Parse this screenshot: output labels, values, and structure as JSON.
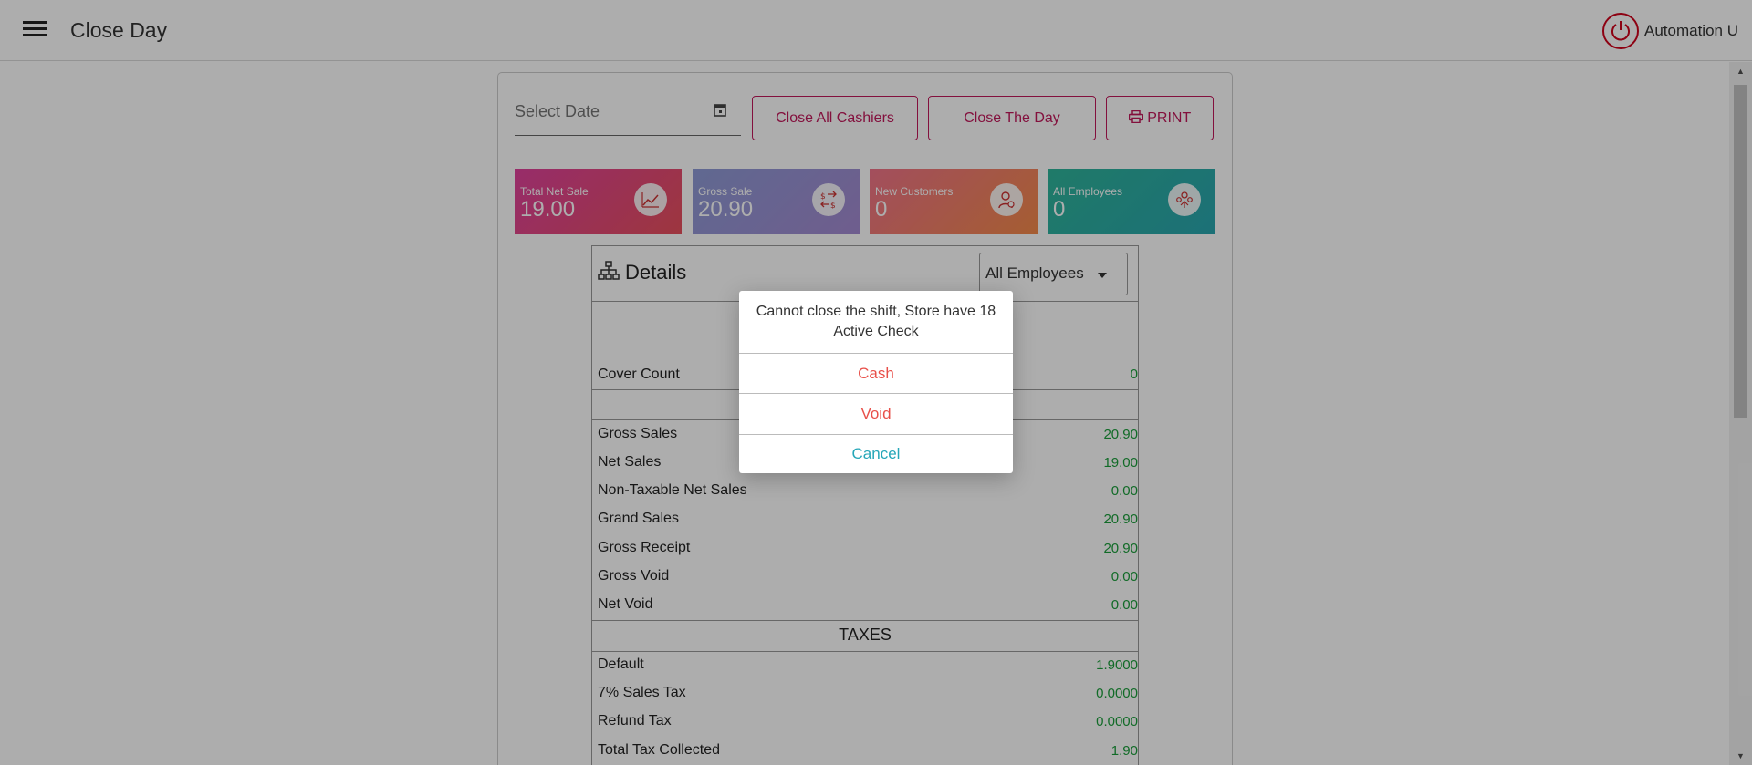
{
  "header": {
    "title": "Close Day",
    "user": "Automation U"
  },
  "toolbar": {
    "date_placeholder": "Select Date",
    "close_all_cashiers": "Close All Cashiers",
    "close_the_day": "Close The Day",
    "print": "PRINT"
  },
  "tiles": [
    {
      "label": "Total Net Sale",
      "value": "19.00",
      "icon": "chart-line-icon"
    },
    {
      "label": "Gross Sale",
      "value": "20.90",
      "icon": "exchange-icon"
    },
    {
      "label": "New Customers",
      "value": "0",
      "icon": "user-add-icon"
    },
    {
      "label": "All Employees",
      "value": "0",
      "icon": "group-icon"
    }
  ],
  "details": {
    "title": "Details",
    "employee_filter": "All Employees",
    "cover_count": {
      "label": "Cover Count",
      "value": "0"
    },
    "sales": [
      {
        "label": "Gross Sales",
        "value": "20.90"
      },
      {
        "label": "Net Sales",
        "value": "19.00"
      },
      {
        "label": "Non-Taxable Net Sales",
        "value": "0.00"
      },
      {
        "label": "Grand Sales",
        "value": "20.90"
      },
      {
        "label": "Gross Receipt",
        "value": "20.90"
      },
      {
        "label": "Gross Void",
        "value": "0.00"
      },
      {
        "label": "Net Void",
        "value": "0.00"
      }
    ],
    "taxes_title": "TAXES",
    "taxes": [
      {
        "label": "Default",
        "value": "1.9000"
      },
      {
        "label": "7% Sales Tax",
        "value": "0.0000"
      },
      {
        "label": "Refund Tax",
        "value": "0.0000"
      },
      {
        "label": "Total Tax Collected",
        "value": "1.90"
      }
    ]
  },
  "dialog": {
    "message": "Cannot close the shift, Store have 18 Active Check",
    "cash": "Cash",
    "void": "Void",
    "cancel": "Cancel"
  },
  "colors": {
    "accent": "#c2185b",
    "value_green": "#1a9e3a",
    "dialog_red": "#e8504a",
    "dialog_teal": "#26a7b8"
  }
}
